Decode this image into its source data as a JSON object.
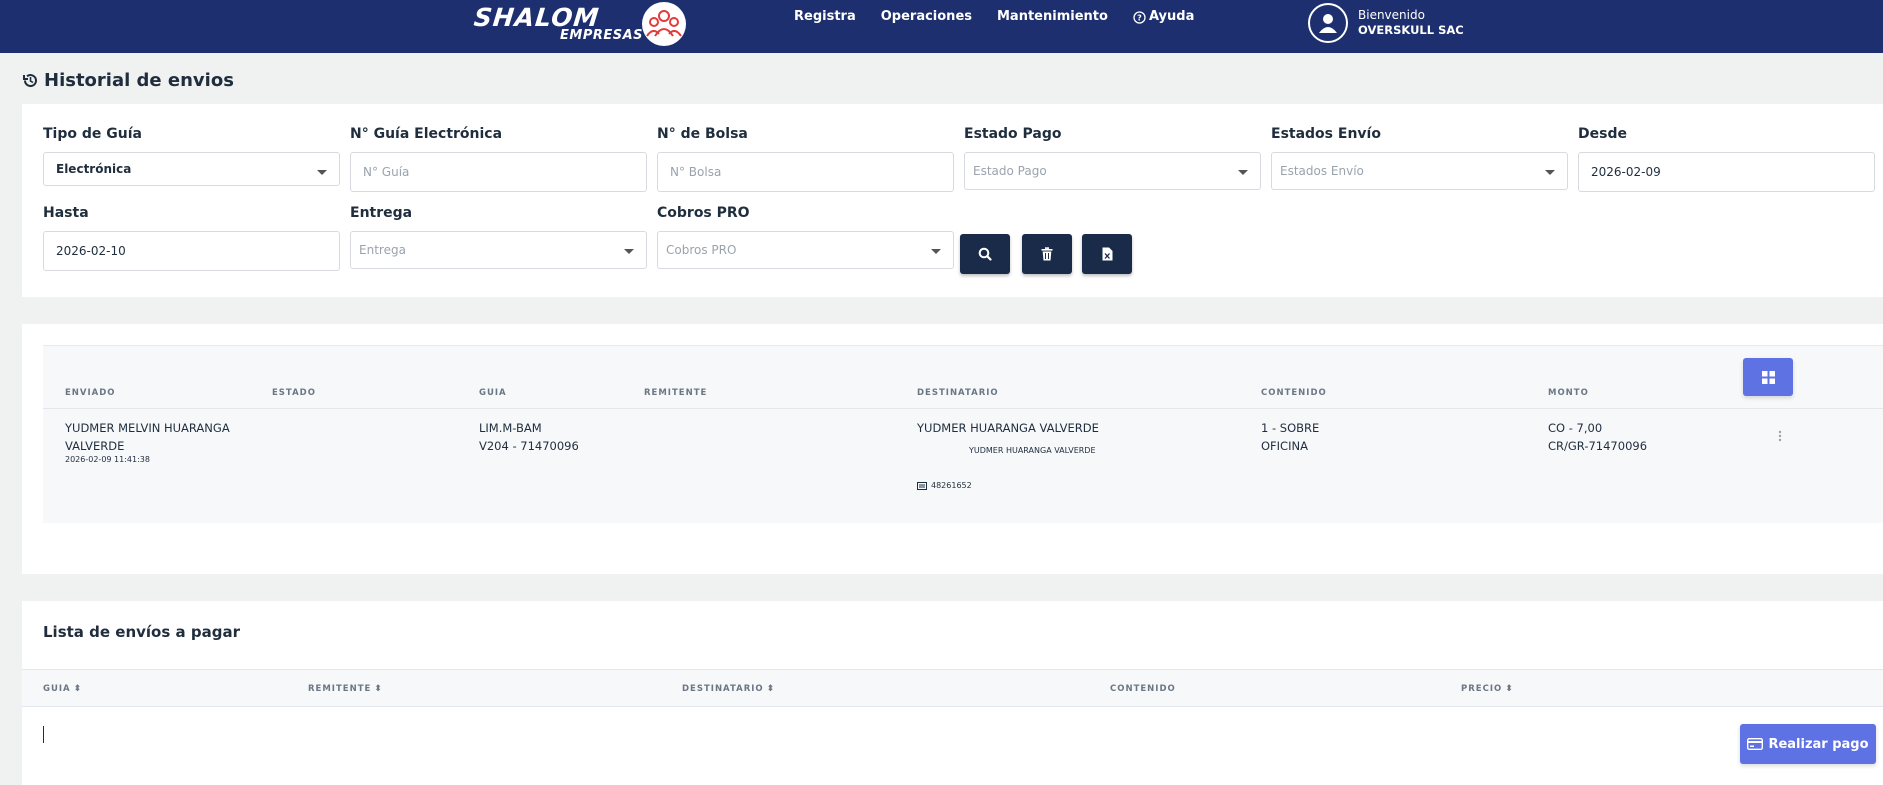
{
  "nav": {
    "brand": "SHALOM",
    "brand_sub": "EMPRESAS",
    "links": [
      "Registra",
      "Operaciones",
      "Mantenimiento",
      "Ayuda"
    ],
    "welcome": "Bienvenido",
    "company": "OVERSKULL SAC"
  },
  "page_title": "Historial de envios",
  "filters": {
    "tipo_guia": {
      "label": "Tipo de Guía",
      "value": "Electrónica"
    },
    "guia_electronica": {
      "label": "N° Guía Electrónica",
      "placeholder": "N° Guía"
    },
    "bolsa": {
      "label": "N° de Bolsa",
      "placeholder": "N° Bolsa"
    },
    "estado_pago": {
      "label": "Estado Pago",
      "placeholder": "Estado Pago"
    },
    "estados_envio": {
      "label": "Estados Envío",
      "placeholder": "Estados Envío"
    },
    "desde": {
      "label": "Desde",
      "value": "2026-02-09"
    },
    "hasta": {
      "label": "Hasta",
      "value": "2026-02-10"
    },
    "entrega": {
      "label": "Entrega",
      "placeholder": "Entrega"
    },
    "cobros_pro": {
      "label": "Cobros PRO",
      "placeholder": "Cobros PRO"
    }
  },
  "envios_table": {
    "headers": [
      "ENVIADO",
      "ESTADO",
      "GUIA",
      "REMITENTE",
      "DESTINATARIO",
      "CONTENIDO",
      "MONTO"
    ],
    "rows": [
      {
        "enviado_line1": "YUDMER MELVIN HUARANGA",
        "enviado_line2": "VALVERDE",
        "enviado_date": "2026-02-09 11:41:38",
        "guia_line1": "LIM.M-BAM",
        "guia_line2": "V204 - 71470096",
        "destinatario": "YUDMER HUARANGA VALVERDE",
        "destinatario_sub": "YUDMER HUARANGA VALVERDE",
        "destinatario_doc": "48261652",
        "contenido_line1": "1 - SOBRE",
        "contenido_line2": "OFICINA",
        "monto_line1": "CO - 7,00",
        "monto_line2": "CR/GR-71470096"
      }
    ]
  },
  "pagar": {
    "title": "Lista de envíos a pagar",
    "headers": [
      "GUIA",
      "REMITENTE",
      "DESTINATARIO",
      "CONTENIDO",
      "PRECIO"
    ],
    "pay_button": "Realizar pago"
  },
  "colors": {
    "nav_bg": "#1d2f6f",
    "dark_button": "#1a2b4a",
    "accent": "#5e72e4"
  }
}
